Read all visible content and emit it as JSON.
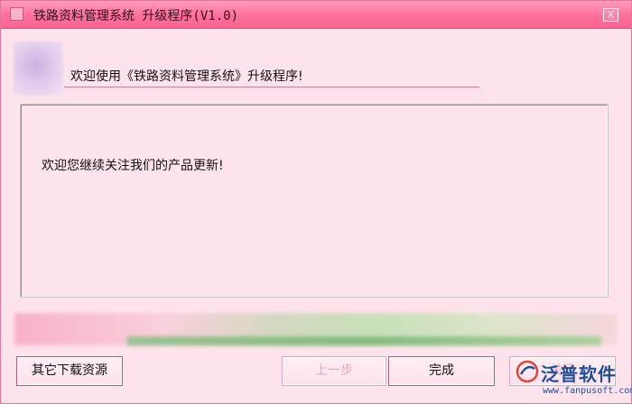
{
  "window": {
    "title": "铁路资料管理系统 升级程序(V1.0)",
    "close_label": "X"
  },
  "header": {
    "welcome_text": "欢迎使用《铁路资料管理系统》升级程序!"
  },
  "content": {
    "message": "欢迎您继续关注我们的产品更新!"
  },
  "buttons": {
    "other_downloads": "其它下载资源",
    "previous": "上一步",
    "finish": "完成",
    "cancel": "关闭"
  },
  "watermark": {
    "brand": "泛普软件",
    "url": "www.fanpusoft.com"
  },
  "colors": {
    "title_bar": "#ff6f9b",
    "background": "#ffe3ec",
    "brand_blue": "#1d4f9a"
  }
}
